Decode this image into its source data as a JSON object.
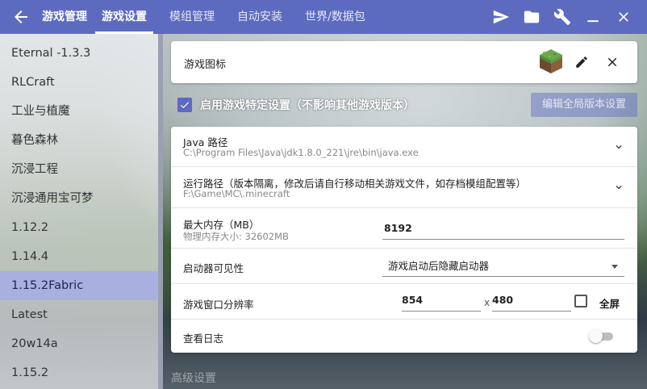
{
  "titlebar": {
    "app_title": "游戏管理",
    "tabs": [
      {
        "label": "游戏设置",
        "active": true
      },
      {
        "label": "模组管理",
        "active": false
      },
      {
        "label": "自动安装",
        "active": false
      },
      {
        "label": "世界/数据包",
        "active": false
      }
    ],
    "icons": [
      "send-icon",
      "folder-icon",
      "wrench-icon",
      "minimize-icon",
      "close-icon"
    ],
    "color": "#5c6bc0"
  },
  "sidebar": {
    "items": [
      {
        "label": "Eternal -1.3.3"
      },
      {
        "label": "RLCraft"
      },
      {
        "label": "工业与植魔"
      },
      {
        "label": "暮色森林"
      },
      {
        "label": "沉浸工程"
      },
      {
        "label": "沉浸通用宝可梦"
      },
      {
        "label": "1.12.2"
      },
      {
        "label": "1.14.4"
      },
      {
        "label": "1.15.2Fabric",
        "selected": true
      },
      {
        "label": "Latest"
      },
      {
        "label": "20w14a"
      },
      {
        "label": "1.15.2"
      }
    ],
    "selected_color": "#a8b0e0"
  },
  "game_icon_card": {
    "label": "游戏图标",
    "icon": "grass-block-icon"
  },
  "specific_settings": {
    "checked": true,
    "label": "启用游戏特定设置（不影响其他游戏版本）",
    "global_button": "编辑全局版本设置"
  },
  "settings": {
    "java": {
      "title": "Java 路径",
      "value": "C:\\Program Files\\Java\\jdk1.8.0_221\\jre\\bin\\java.exe"
    },
    "run_dir": {
      "title": "运行路径（版本隔离，修改后请自行移动相关游戏文件，如存档模组配置等）",
      "value": "F:\\Game\\MC\\.minecraft"
    },
    "memory": {
      "title": "最大内存（MB）",
      "subtitle": "物理内存大小: 32602MB",
      "value": "8192"
    },
    "launcher_visibility": {
      "title": "启动器可见性",
      "value": "游戏启动后隐藏启动器"
    },
    "resolution": {
      "title": "游戏窗口分辨率",
      "width": "854",
      "separator": "x",
      "height": "480",
      "fullscreen_label": "全屏",
      "fullscreen": false
    },
    "log": {
      "title": "查看日志",
      "enabled": false
    }
  },
  "advanced_label": "高级设置"
}
